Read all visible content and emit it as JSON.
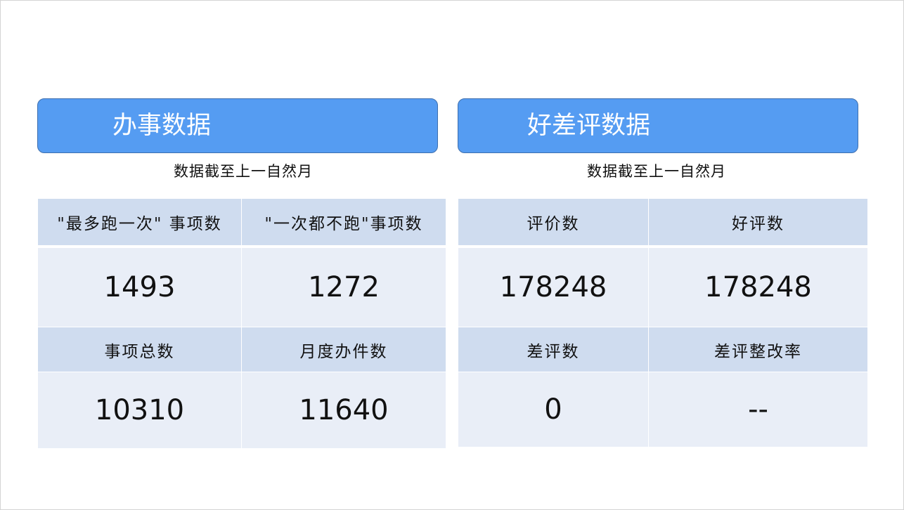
{
  "left_panel": {
    "title": "办事数据",
    "subtitle": "数据截至上一自然月",
    "headers_row1": [
      "\"最多跑一次\" 事项数",
      "\"一次都不跑\"事项数"
    ],
    "values_row1": [
      "1493",
      "1272"
    ],
    "headers_row2": [
      "事项总数",
      "月度办件数"
    ],
    "values_row2": [
      "10310",
      "11640"
    ]
  },
  "right_panel": {
    "title": "好差评数据",
    "subtitle": "数据截至上一自然月",
    "headers_row1": [
      "评价数",
      "好评数"
    ],
    "values_row1": [
      "178248",
      "178248"
    ],
    "headers_row2": [
      "差评数",
      "差评整改率"
    ],
    "values_row2": [
      "0",
      "--"
    ]
  },
  "colors": {
    "header_bar": "#559cf2",
    "header_border": "#3e6fae",
    "table_head_bg": "#cfdcef",
    "table_value_bg": "#e9eef7",
    "text": "#111111"
  }
}
